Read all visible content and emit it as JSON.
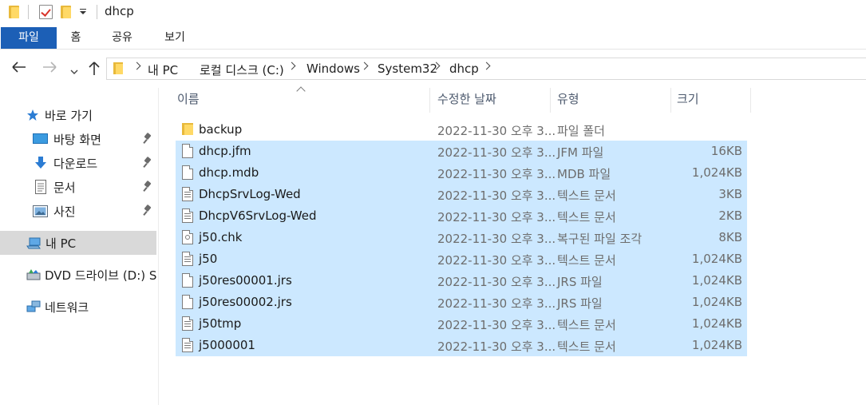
{
  "titlebar": {
    "title": "dhcp"
  },
  "ribbon": {
    "tabs": [
      {
        "label": "파일"
      },
      {
        "label": "홈"
      },
      {
        "label": "공유"
      },
      {
        "label": "보기"
      }
    ]
  },
  "address_bar": {
    "crumbs": [
      "내 PC",
      "로컬 디스크 (C:)",
      "Windows",
      "System32",
      "dhcp"
    ]
  },
  "sidebar": {
    "items": [
      {
        "label": "바로 가기",
        "icon": "star-icon"
      },
      {
        "label": "바탕 화면",
        "icon": "desktop-icon",
        "pinned": true
      },
      {
        "label": "다운로드",
        "icon": "download-arrow-icon",
        "pinned": true
      },
      {
        "label": "문서",
        "icon": "document-icon",
        "pinned": true
      },
      {
        "label": "사진",
        "icon": "pictures-icon",
        "pinned": true
      },
      {
        "label": "내 PC",
        "icon": "computer-icon",
        "selected": true
      },
      {
        "label": "DVD 드라이브 (D:) S",
        "icon": "dvd-drive-icon"
      },
      {
        "label": "네트워크",
        "icon": "network-icon"
      }
    ]
  },
  "columns": {
    "name": "이름",
    "date": "수정한 날짜",
    "type": "유형",
    "size": "크기"
  },
  "files": [
    {
      "name": "backup",
      "date": "2022-11-30 오후 3...",
      "type": "파일 폴더",
      "size": "",
      "icon": "folder-icon",
      "selected": false
    },
    {
      "name": "dhcp.jfm",
      "date": "2022-11-30 오후 3...",
      "type": "JFM 파일",
      "size": "16KB",
      "icon": "file-icon",
      "selected": true
    },
    {
      "name": "dhcp.mdb",
      "date": "2022-11-30 오후 3...",
      "type": "MDB 파일",
      "size": "1,024KB",
      "icon": "file-icon",
      "selected": true
    },
    {
      "name": "DhcpSrvLog-Wed",
      "date": "2022-11-30 오후 3...",
      "type": "텍스트 문서",
      "size": "3KB",
      "icon": "text-file-icon",
      "selected": true
    },
    {
      "name": "DhcpV6SrvLog-Wed",
      "date": "2022-11-30 오후 3...",
      "type": "텍스트 문서",
      "size": "2KB",
      "icon": "text-file-icon",
      "selected": true
    },
    {
      "name": "j50.chk",
      "date": "2022-11-30 오후 3...",
      "type": "복구된 파일 조각",
      "size": "8KB",
      "icon": "chk-file-icon",
      "selected": true
    },
    {
      "name": "j50",
      "date": "2022-11-30 오후 3...",
      "type": "텍스트 문서",
      "size": "1,024KB",
      "icon": "text-file-icon",
      "selected": true
    },
    {
      "name": "j50res00001.jrs",
      "date": "2022-11-30 오후 3...",
      "type": "JRS 파일",
      "size": "1,024KB",
      "icon": "file-icon",
      "selected": true
    },
    {
      "name": "j50res00002.jrs",
      "date": "2022-11-30 오후 3...",
      "type": "JRS 파일",
      "size": "1,024KB",
      "icon": "file-icon",
      "selected": true
    },
    {
      "name": "j50tmp",
      "date": "2022-11-30 오후 3...",
      "type": "텍스트 문서",
      "size": "1,024KB",
      "icon": "text-file-icon",
      "selected": true
    },
    {
      "name": "j5000001",
      "date": "2022-11-30 오후 3...",
      "type": "텍스트 문서",
      "size": "1,024KB",
      "icon": "text-file-icon",
      "selected": true
    }
  ]
}
